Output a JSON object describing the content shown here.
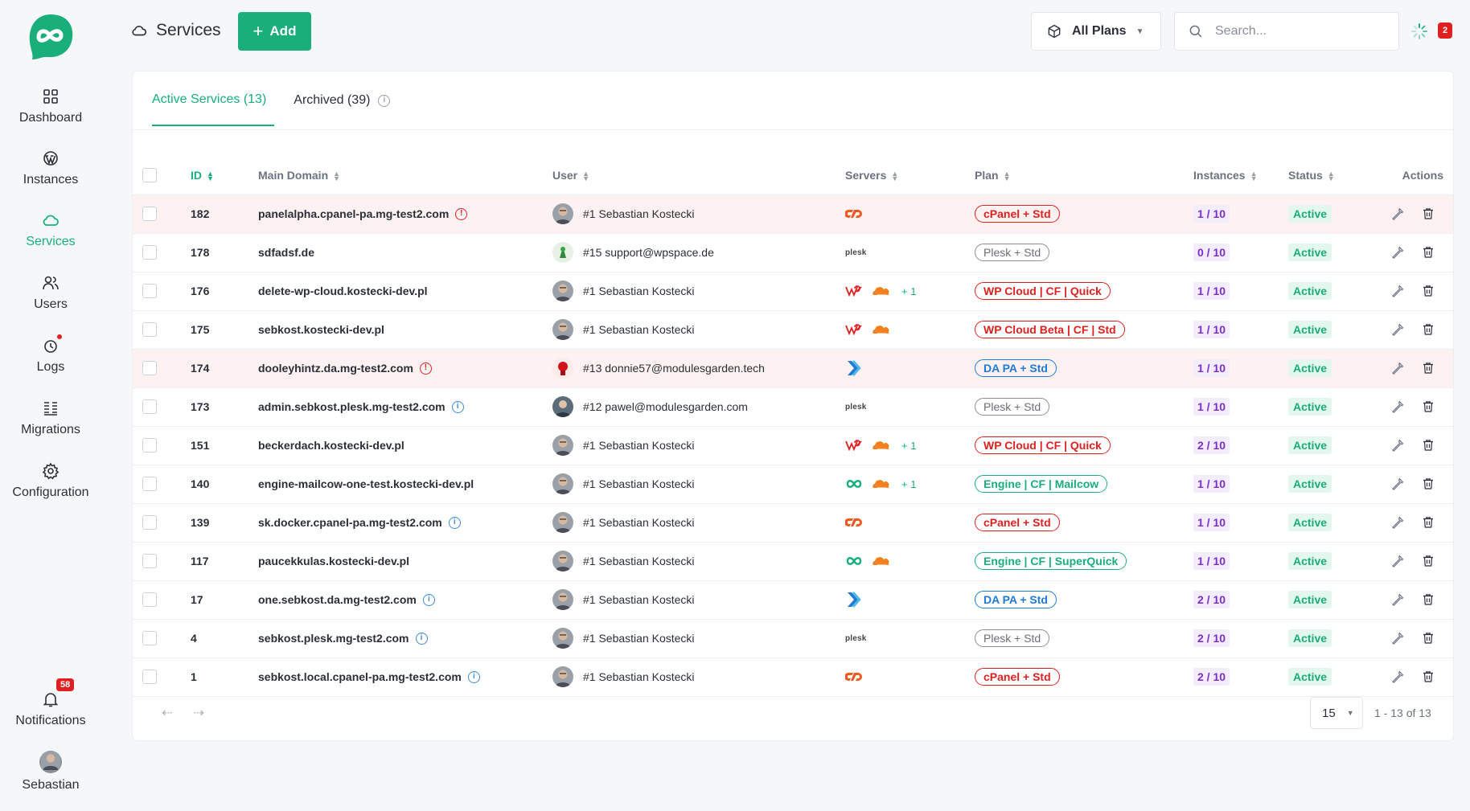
{
  "sidebar": {
    "items": [
      {
        "label": "Dashboard",
        "icon": "dashboard-icon",
        "active": false
      },
      {
        "label": "Instances",
        "icon": "wordpress-icon",
        "active": false
      },
      {
        "label": "Services",
        "icon": "cloud-icon",
        "active": true
      },
      {
        "label": "Users",
        "icon": "users-icon",
        "active": false
      },
      {
        "label": "Logs",
        "icon": "logs-icon",
        "active": false
      },
      {
        "label": "Migrations",
        "icon": "migrations-icon",
        "active": false
      },
      {
        "label": "Configuration",
        "icon": "gear-icon",
        "active": false
      }
    ],
    "notifications": {
      "label": "Notifications",
      "badge": "58"
    },
    "profile": {
      "label": "Sebastian"
    }
  },
  "header": {
    "title": "Services",
    "add_label": "Add",
    "plans_label": "All Plans",
    "search_placeholder": "Search...",
    "badge": "2"
  },
  "tabs": [
    {
      "label": "Active Services (13)",
      "active": true
    },
    {
      "label": "Archived (39)",
      "active": false
    }
  ],
  "table": {
    "headers": {
      "id": "ID",
      "domain": "Main Domain",
      "user": "User",
      "servers": "Servers",
      "plan": "Plan",
      "instances": "Instances",
      "status": "Status",
      "actions": "Actions"
    },
    "rows": [
      {
        "id": "182",
        "domain": "panelalpha.cpanel-pa.mg-test2.com",
        "flag": "error",
        "user": "#1 Sebastian Kostecki",
        "servers": [
          "cpanel"
        ],
        "extra": "",
        "plan": "cPanel + Std",
        "plan_color": "red",
        "instances": "1 / 10",
        "status": "Active",
        "warn": true
      },
      {
        "id": "178",
        "domain": "sdfadsf.de",
        "flag": "",
        "user": "#15 support@wpspace.de",
        "servers": [
          "plesk"
        ],
        "extra": "",
        "plan": "Plesk + Std",
        "plan_color": "gray",
        "instances": "0 / 10",
        "status": "Active",
        "warn": false
      },
      {
        "id": "176",
        "domain": "delete-wp-cloud.kostecki-dev.pl",
        "flag": "",
        "user": "#1 Sebastian Kostecki",
        "servers": [
          "wpcloud",
          "cloudflare"
        ],
        "extra": "+ 1",
        "plan": "WP Cloud | CF | Quick",
        "plan_color": "red",
        "instances": "1 / 10",
        "status": "Active",
        "warn": false
      },
      {
        "id": "175",
        "domain": "sebkost.kostecki-dev.pl",
        "flag": "",
        "user": "#1 Sebastian Kostecki",
        "servers": [
          "wpcloud",
          "cloudflare"
        ],
        "extra": "",
        "plan": "WP Cloud Beta | CF | Std",
        "plan_color": "red",
        "instances": "1 / 10",
        "status": "Active",
        "warn": false
      },
      {
        "id": "174",
        "domain": "dooleyhintz.da.mg-test2.com",
        "flag": "error",
        "user": "#13 donnie57@modulesgarden.tech",
        "servers": [
          "directadmin"
        ],
        "extra": "",
        "plan": "DA PA + Std",
        "plan_color": "blue",
        "instances": "1 / 10",
        "status": "Active",
        "warn": true
      },
      {
        "id": "173",
        "domain": "admin.sebkost.plesk.mg-test2.com",
        "flag": "info",
        "user": "#12 pawel@modulesgarden.com",
        "servers": [
          "plesk"
        ],
        "extra": "",
        "plan": "Plesk + Std",
        "plan_color": "gray",
        "instances": "1 / 10",
        "status": "Active",
        "warn": false
      },
      {
        "id": "151",
        "domain": "beckerdach.kostecki-dev.pl",
        "flag": "",
        "user": "#1 Sebastian Kostecki",
        "servers": [
          "wpcloud",
          "cloudflare"
        ],
        "extra": "+ 1",
        "plan": "WP Cloud | CF | Quick",
        "plan_color": "red",
        "instances": "2 / 10",
        "status": "Active",
        "warn": false
      },
      {
        "id": "140",
        "domain": "engine-mailcow-one-test.kostecki-dev.pl",
        "flag": "",
        "user": "#1 Sebastian Kostecki",
        "servers": [
          "engine",
          "cloudflare"
        ],
        "extra": "+ 1",
        "plan": "Engine | CF | Mailcow",
        "plan_color": "green",
        "instances": "1 / 10",
        "status": "Active",
        "warn": false
      },
      {
        "id": "139",
        "domain": "sk.docker.cpanel-pa.mg-test2.com",
        "flag": "info",
        "user": "#1 Sebastian Kostecki",
        "servers": [
          "cpanel"
        ],
        "extra": "",
        "plan": "cPanel + Std",
        "plan_color": "red",
        "instances": "1 / 10",
        "status": "Active",
        "warn": false
      },
      {
        "id": "117",
        "domain": "paucekkulas.kostecki-dev.pl",
        "flag": "",
        "user": "#1 Sebastian Kostecki",
        "servers": [
          "engine",
          "cloudflare"
        ],
        "extra": "",
        "plan": "Engine | CF | SuperQuick",
        "plan_color": "green",
        "instances": "1 / 10",
        "status": "Active",
        "warn": false
      },
      {
        "id": "17",
        "domain": "one.sebkost.da.mg-test2.com",
        "flag": "info",
        "user": "#1 Sebastian Kostecki",
        "servers": [
          "directadmin"
        ],
        "extra": "",
        "plan": "DA PA + Std",
        "plan_color": "blue",
        "instances": "2 / 10",
        "status": "Active",
        "warn": false
      },
      {
        "id": "4",
        "domain": "sebkost.plesk.mg-test2.com",
        "flag": "info",
        "user": "#1 Sebastian Kostecki",
        "servers": [
          "plesk"
        ],
        "extra": "",
        "plan": "Plesk + Std",
        "plan_color": "gray",
        "instances": "2 / 10",
        "status": "Active",
        "warn": false
      },
      {
        "id": "1",
        "domain": "sebkost.local.cpanel-pa.mg-test2.com",
        "flag": "info",
        "user": "#1 Sebastian Kostecki",
        "servers": [
          "cpanel"
        ],
        "extra": "",
        "plan": "cPanel + Std",
        "plan_color": "red",
        "instances": "2 / 10",
        "status": "Active",
        "warn": false
      }
    ]
  },
  "pagination": {
    "per_page": "15",
    "info": "1 - 13 of 13"
  },
  "colors": {
    "accent": "#1aae7a",
    "danger": "#e02020",
    "info": "#1f7ad6"
  }
}
